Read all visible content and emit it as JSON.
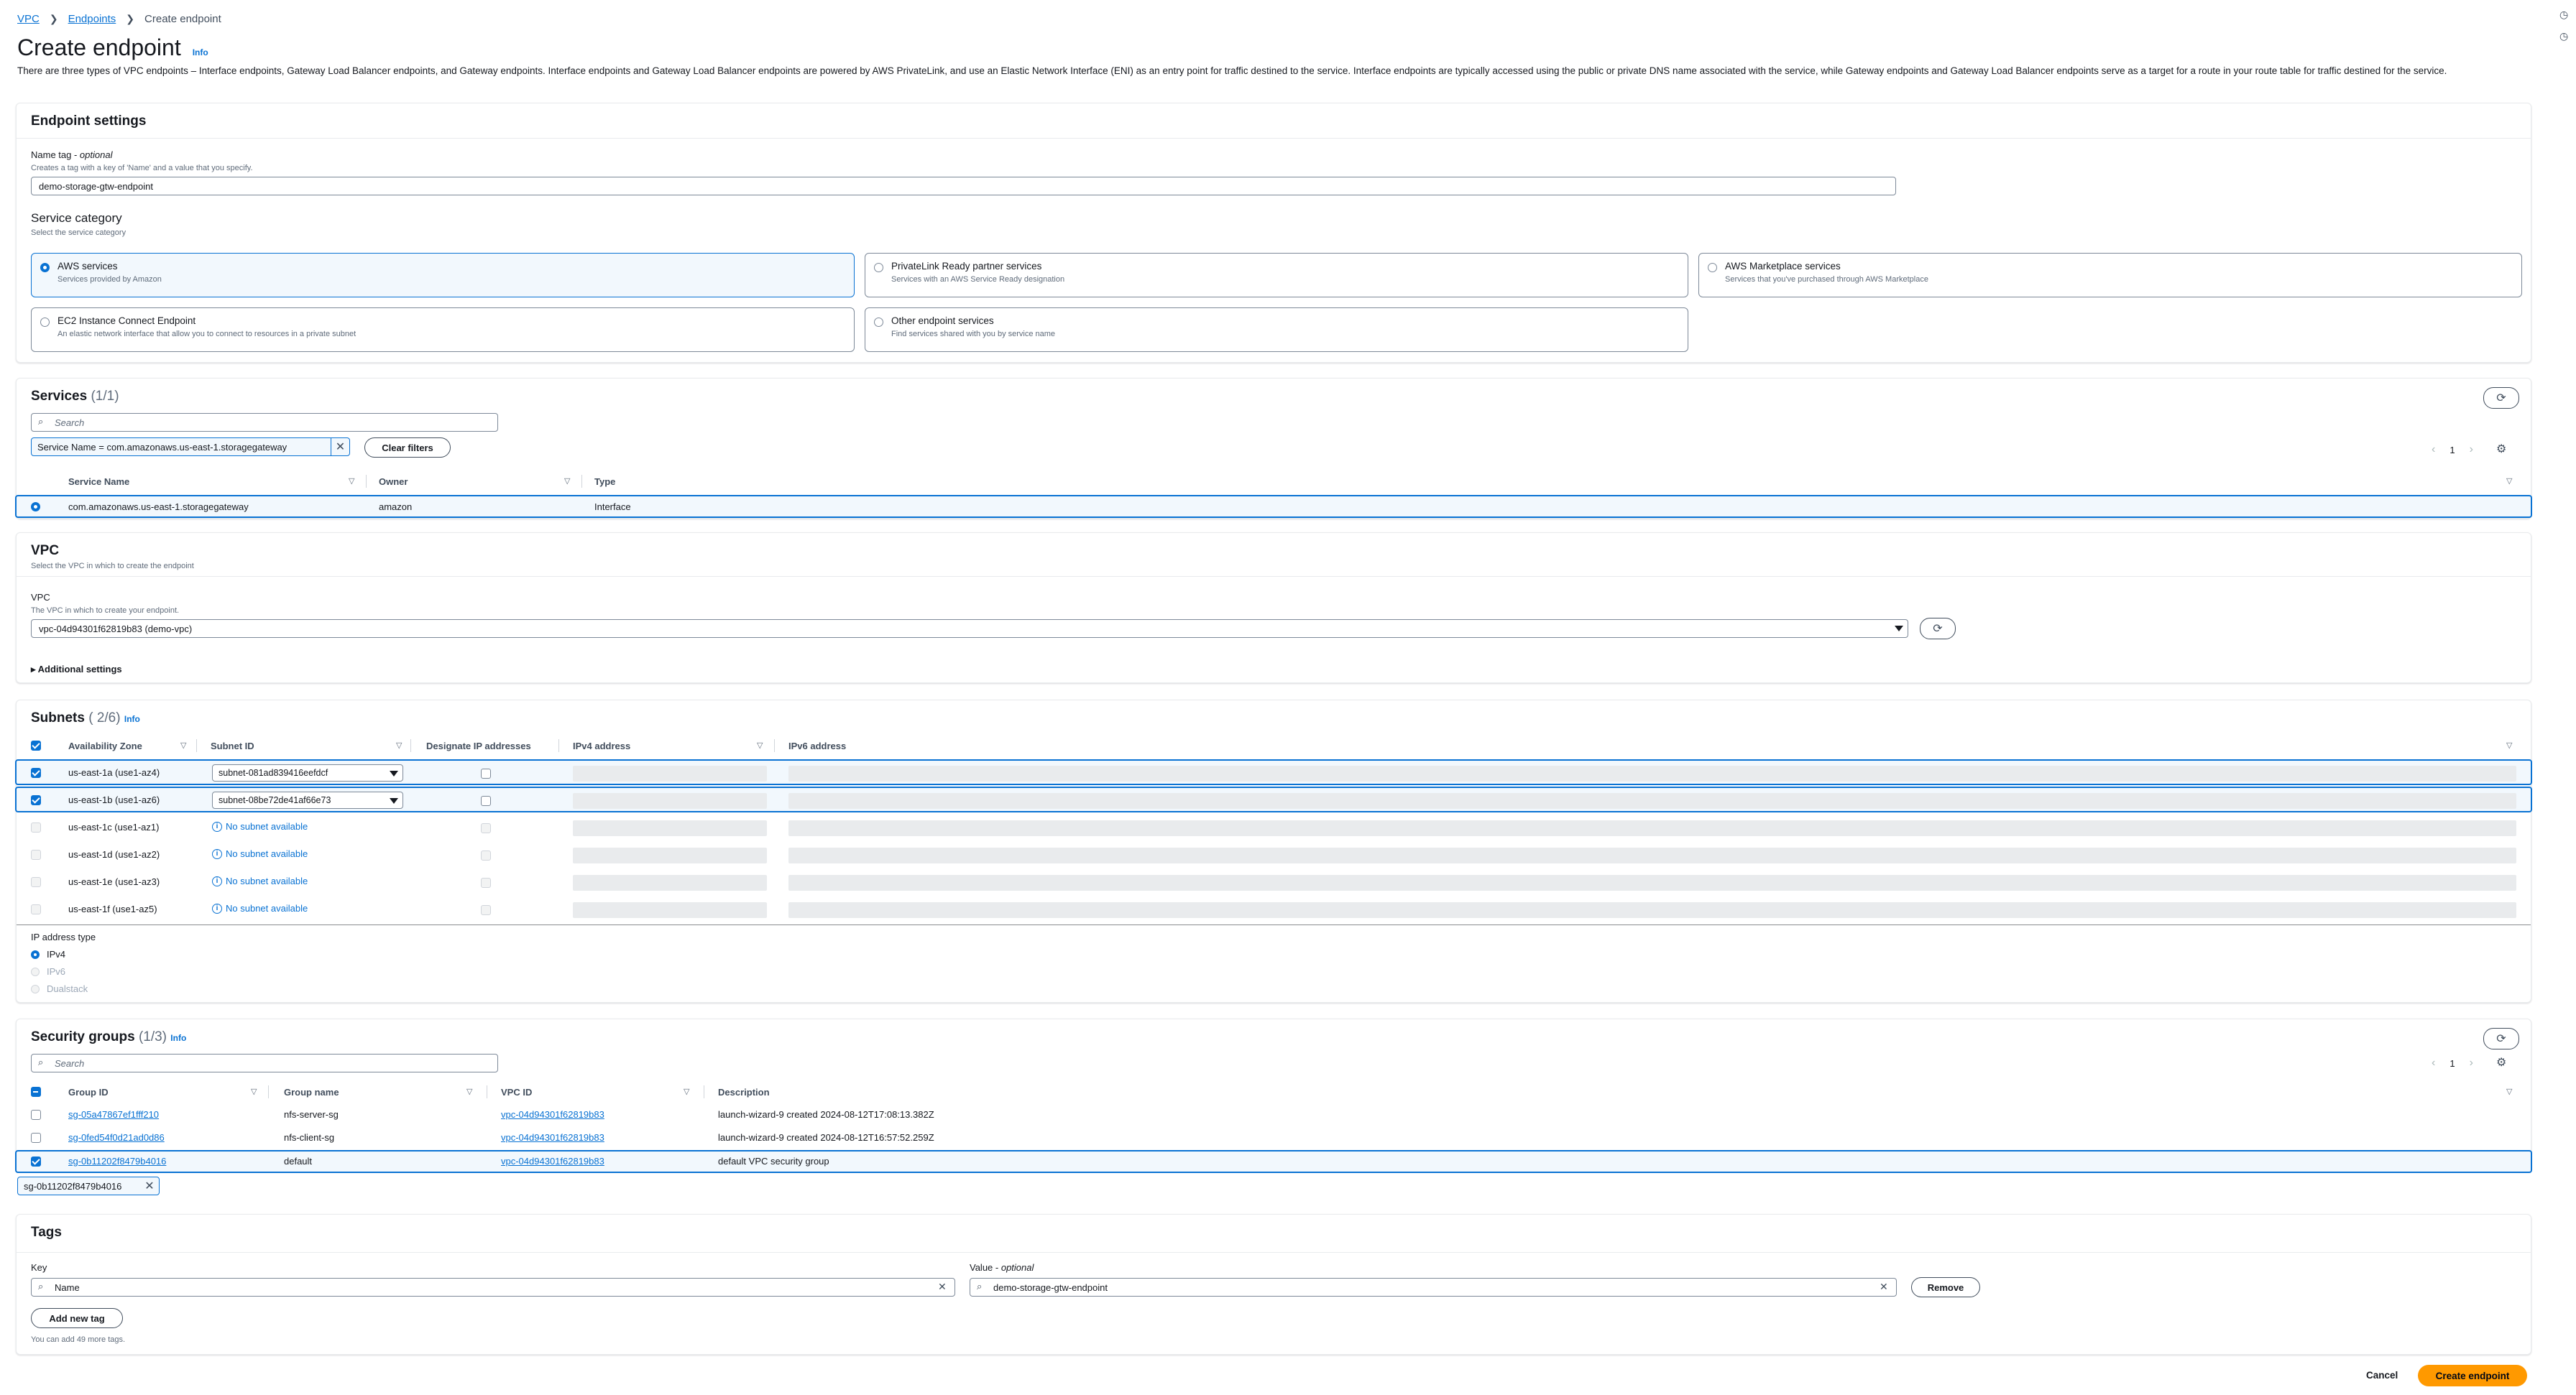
{
  "breadcrumb": {
    "vpc": "VPC",
    "endpoints": "Endpoints",
    "current": "Create endpoint"
  },
  "page": {
    "title": "Create endpoint",
    "info": "Info",
    "intro": "There are three types of VPC endpoints – Interface endpoints, Gateway Load Balancer endpoints, and Gateway endpoints. Interface endpoints and Gateway Load Balancer endpoints are powered by AWS PrivateLink, and use an Elastic Network Interface (ENI) as an entry point for traffic destined to the service. Interface endpoints are typically accessed using the public or private DNS name associated with the service, while Gateway endpoints and Gateway Load Balancer endpoints serve as a target for a route in your route table for traffic destined for the service."
  },
  "endpoint_settings": {
    "header": "Endpoint settings",
    "name_tag_label": "Name tag - ",
    "name_tag_optional": "optional",
    "name_tag_desc": "Creates a tag with a key of 'Name' and a value that you specify.",
    "name_tag_value": "demo-storage-gtw-endpoint",
    "category_label": "Service category",
    "category_desc": "Select the service category",
    "categories": [
      {
        "title": "AWS services",
        "desc": "Services provided by Amazon"
      },
      {
        "title": "PrivateLink Ready partner services",
        "desc": "Services with an AWS Service Ready designation"
      },
      {
        "title": "AWS Marketplace services",
        "desc": "Services that you've purchased through AWS Marketplace"
      },
      {
        "title": "EC2 Instance Connect Endpoint",
        "desc": "An elastic network interface that allow you to connect to resources in a private subnet"
      },
      {
        "title": "Other endpoint services",
        "desc": "Find services shared with you by service name"
      }
    ]
  },
  "services": {
    "header": "Services",
    "count": "(1/1)",
    "search_placeholder": "Search",
    "filter_token": "Service Name = com.amazonaws.us-east-1.storagegateway",
    "clear_filters": "Clear filters",
    "page": "1",
    "columns": [
      "Service Name",
      "Owner",
      "Type"
    ],
    "rows": [
      [
        "com.amazonaws.us-east-1.storagegateway",
        "amazon",
        "Interface"
      ]
    ]
  },
  "vpc": {
    "header": "VPC",
    "desc": "Select the VPC in which to create the endpoint",
    "label": "VPC",
    "label_desc": "The VPC in which to create your endpoint.",
    "value": "vpc-04d94301f62819b83 (demo-vpc)",
    "additional": "Additional settings"
  },
  "subnets": {
    "header": "Subnets",
    "count": "( 2/6)",
    "info": "Info",
    "columns": [
      "Availability Zone",
      "Subnet ID",
      "Designate IP addresses",
      "IPv4 address",
      "IPv6 address"
    ],
    "rows": [
      {
        "az": "us-east-1a (use1-az4)",
        "subnet": "subnet-081ad839416eefdcf"
      },
      {
        "az": "us-east-1b (use1-az6)",
        "subnet": "subnet-08be72de41af66e73"
      },
      {
        "az": "us-east-1c (use1-az1)",
        "subnet": "No subnet available"
      },
      {
        "az": "us-east-1d (use1-az2)",
        "subnet": "No subnet available"
      },
      {
        "az": "us-east-1e (use1-az3)",
        "subnet": "No subnet available"
      },
      {
        "az": "us-east-1f (use1-az5)",
        "subnet": "No subnet available"
      }
    ],
    "ip_type_label": "IP address type",
    "ip_types": [
      "IPv4",
      "IPv6",
      "Dualstack"
    ]
  },
  "security_groups": {
    "header": "Security groups",
    "count": "(1/3)",
    "info": "Info",
    "search_placeholder": "Search",
    "page": "1",
    "columns": [
      "Group ID",
      "Group name",
      "VPC ID",
      "Description"
    ],
    "rows": [
      [
        "sg-05a47867ef1fff210",
        "nfs-server-sg",
        "vpc-04d94301f62819b83",
        "launch-wizard-9 created 2024-08-12T17:08:13.382Z"
      ],
      [
        "sg-0fed54f0d21ad0d86",
        "nfs-client-sg",
        "vpc-04d94301f62819b83",
        "launch-wizard-9 created 2024-08-12T16:57:52.259Z"
      ],
      [
        "sg-0b11202f8479b4016",
        "default",
        "vpc-04d94301f62819b83",
        "default VPC security group"
      ]
    ],
    "selected_token": "sg-0b11202f8479b4016"
  },
  "tags": {
    "header": "Tags",
    "key_label": "Key",
    "value_label": "Value - ",
    "value_optional": "optional",
    "key_value": "Name",
    "value_value": "demo-storage-gtw-endpoint",
    "remove": "Remove",
    "add": "Add new tag",
    "hint": "You can add 49 more tags."
  },
  "footer": {
    "cancel": "Cancel",
    "create": "Create endpoint"
  },
  "colors": {
    "accent": "#0972d3",
    "primary_button": "#ff9900"
  },
  "icons": [
    "chevron-right-icon",
    "refresh-icon",
    "settings-icon",
    "search-icon",
    "close-icon",
    "info-circle-icon",
    "sort-icon",
    "caret-down-icon"
  ]
}
